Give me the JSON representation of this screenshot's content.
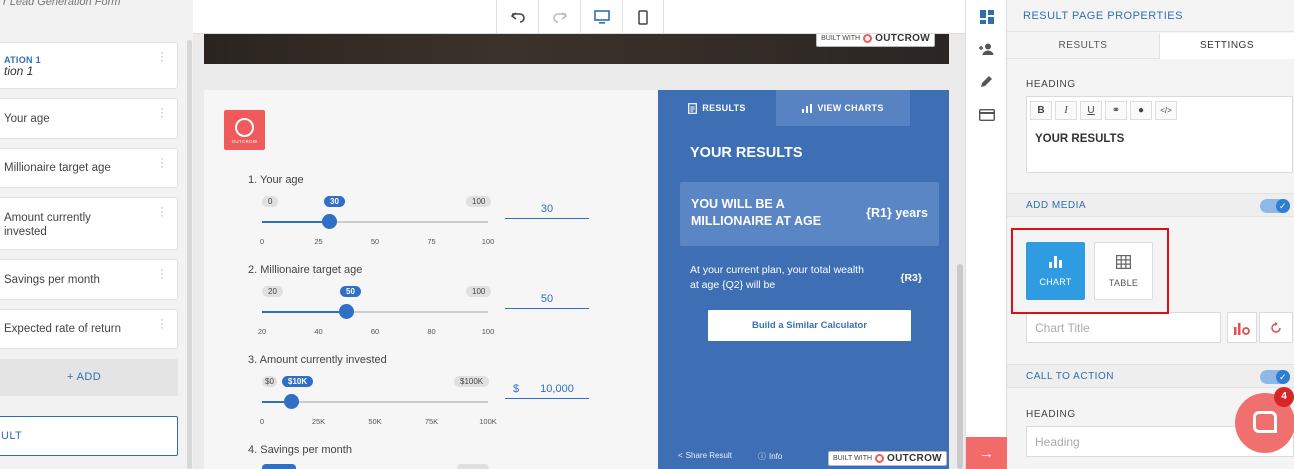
{
  "sidebar": {
    "form_title": "r Lead Generation Form",
    "section_label": "ATION 1",
    "section_title": "tion 1",
    "items": [
      {
        "label": "Your age"
      },
      {
        "label": "Millionaire target age"
      },
      {
        "label": "Amount currently invested"
      },
      {
        "label": "Savings per month"
      },
      {
        "label": "Expected rate of return"
      }
    ],
    "add_label": "+ ADD",
    "result_label": "ULT"
  },
  "canvas": {
    "built_with": "BUILT WITH",
    "brand": "OUTCROW",
    "logo_text": "OUTCROW",
    "questions": [
      {
        "label": "1.  Your age",
        "min": "0",
        "max": "100",
        "current": "30",
        "value": "30",
        "progress": 0.3,
        "ticks": [
          "0",
          "25",
          "50",
          "75",
          "100"
        ]
      },
      {
        "label": "2.  Millionaire target age",
        "min": "20",
        "max": "100",
        "current": "50",
        "value": "50",
        "progress": 0.375,
        "ticks": [
          "20",
          "40",
          "60",
          "80",
          "100"
        ]
      },
      {
        "label": "3.  Amount currently invested",
        "min": "$0",
        "max": "$100K",
        "current": "$10K",
        "value": "10,000",
        "currency": "$",
        "progress": 0.13,
        "ticks": [
          "0",
          "25K",
          "50K",
          "75K",
          "100K"
        ]
      },
      {
        "label": "4.  Savings per month"
      }
    ]
  },
  "results": {
    "tab_results": "RESULTS",
    "tab_charts": "VIEW CHARTS",
    "title": "YOUR RESULTS",
    "box_left": "YOU WILL BE A MILLIONAIRE AT AGE",
    "box_right": "{R1} years",
    "line": "At your current plan, your total wealth at age {Q2} will be",
    "line_value": "{R3}",
    "button": "Build a Similar Calculator",
    "share": "Share Result",
    "info": "Info",
    "built_with": "BUILT WITH",
    "brand": "OUTCROW"
  },
  "props": {
    "header": "RESULT PAGE PROPERTIES",
    "tab_results": "RESULTS",
    "tab_settings": "SETTINGS",
    "heading_label": "HEADING",
    "heading_value": "YOUR RESULTS",
    "add_media": "ADD MEDIA",
    "chart_label": "CHART",
    "table_label": "TABLE",
    "chart_title_placeholder": "Chart Title",
    "cta": "CALL TO ACTION",
    "cta_heading_label": "HEADING",
    "cta_heading_placeholder": "Heading"
  },
  "chat": {
    "badge": "4"
  },
  "colors": {
    "accent": "#2f6fc4",
    "results_bg": "#3e6fb5",
    "brand": "#f05a5a"
  }
}
